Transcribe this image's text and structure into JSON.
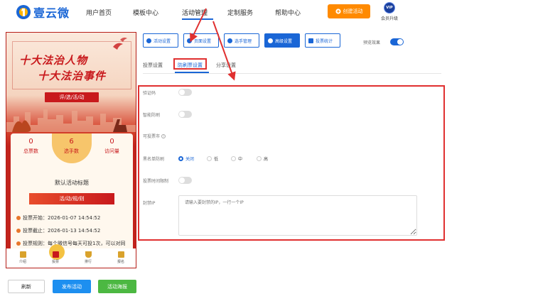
{
  "topnav": {
    "logo_text": "壹云微",
    "items": [
      "用户首页",
      "模板中心",
      "活动管理",
      "定制服务",
      "帮助中心"
    ],
    "create_label": "创建活动",
    "vip_badge": "VIP",
    "vip_label": "会员升级"
  },
  "preview": {
    "poster_line1": "十大法治人物",
    "poster_line2": "十大法治事件",
    "poster_ribbon": "评/选/活/动",
    "stats": [
      {
        "value": "0",
        "label": "总票数"
      },
      {
        "value": "6",
        "label": "选手数"
      },
      {
        "value": "0",
        "label": "访问量"
      }
    ],
    "info_title": "默认活动标题",
    "info_banner": "活/动/规/则",
    "rows": [
      "投票开始：2026-01-07 14:54:52",
      "投票截止：2026-01-13 14:54:52",
      "投票规则：每个微信号每天可投1次，可以对同"
    ],
    "tabs": [
      "介绍",
      "投票",
      "排行",
      "报名"
    ]
  },
  "buttons": {
    "refresh": "刷新",
    "publish": "发布活动",
    "poster": "活动海报"
  },
  "toolbar": {
    "items": [
      "活动设置",
      "页面设置",
      "选手管理",
      "高级设置",
      "投票统计"
    ],
    "preview_label": "预览效果"
  },
  "subtabs": [
    "投票设置",
    "防刷票设置",
    "分享设置"
  ],
  "form": {
    "captcha_label": "验证码",
    "smart_label": "智能防刷",
    "city_label": "可投票市",
    "blacklist_label": "黑名单防刷",
    "blacklist_options": [
      "关闭",
      "低",
      "中",
      "高"
    ],
    "time_limit_label": "投票时间限制",
    "ip_label": "封禁IP",
    "ip_placeholder": "请输入要封禁的IP，一行一个IP"
  },
  "colors": {
    "primary": "#1a66d6",
    "accent": "#ff8a00",
    "highlight": "#e03030",
    "poster_red": "#c8191c"
  }
}
